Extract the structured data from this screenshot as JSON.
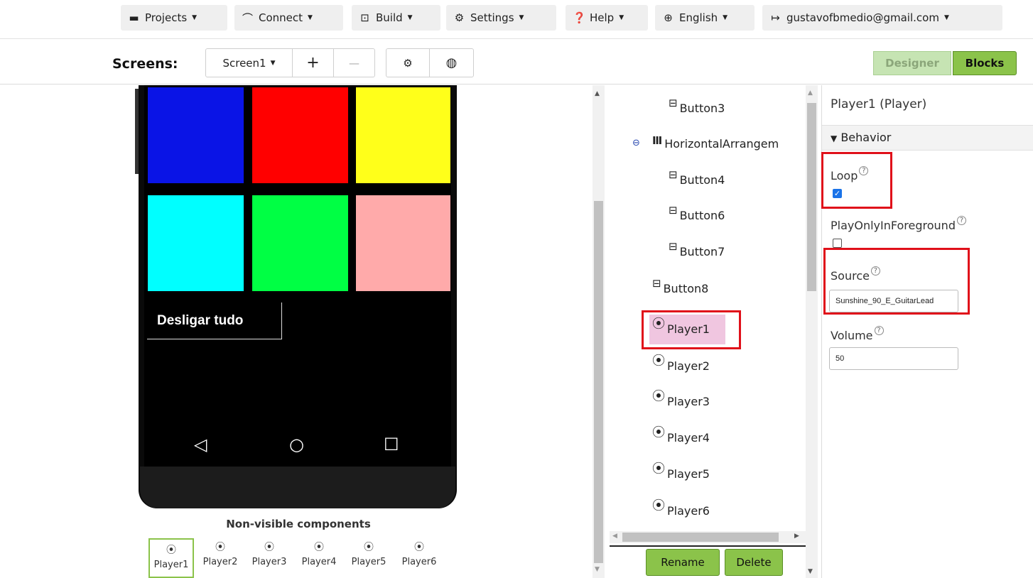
{
  "menu": {
    "projects": "Projects",
    "connect": "Connect",
    "build": "Build",
    "settings": "Settings",
    "help": "Help",
    "language": "English",
    "account": "gustavofbmedio@gmail.com"
  },
  "screens": {
    "label": "Screens:",
    "current": "Screen1",
    "add": "+",
    "remove": "—"
  },
  "view_toggle": {
    "designer": "Designer",
    "blocks": "Blocks"
  },
  "phone": {
    "tile_colors": [
      "#0a14e6",
      "#ff0000",
      "#ffff1a",
      "#00ffff",
      "#00ff44",
      "#ffaaaa"
    ],
    "button_label": "Desligar tudo"
  },
  "non_visible": {
    "title": "Non-visible components",
    "items": [
      "Player1",
      "Player2",
      "Player3",
      "Player4",
      "Player5",
      "Player6"
    ]
  },
  "tree": {
    "items": {
      "button3": "Button3",
      "horizontal": "HorizontalArrangem",
      "button4": "Button4",
      "button6": "Button6",
      "button7": "Button7",
      "button8": "Button8",
      "player1": "Player1",
      "player2": "Player2",
      "player3": "Player3",
      "player4": "Player4",
      "player5": "Player5",
      "player6": "Player6"
    },
    "rename": "Rename",
    "delete": "Delete"
  },
  "properties": {
    "title": "Player1 (Player)",
    "section": "Behavior",
    "loop_label": "Loop",
    "loop_checked": true,
    "foreground_label": "PlayOnlyInForeground",
    "foreground_checked": false,
    "source_label": "Source",
    "source_value": "Sunshine_90_E_GuitarLead",
    "volume_label": "Volume",
    "volume_value": "50"
  }
}
